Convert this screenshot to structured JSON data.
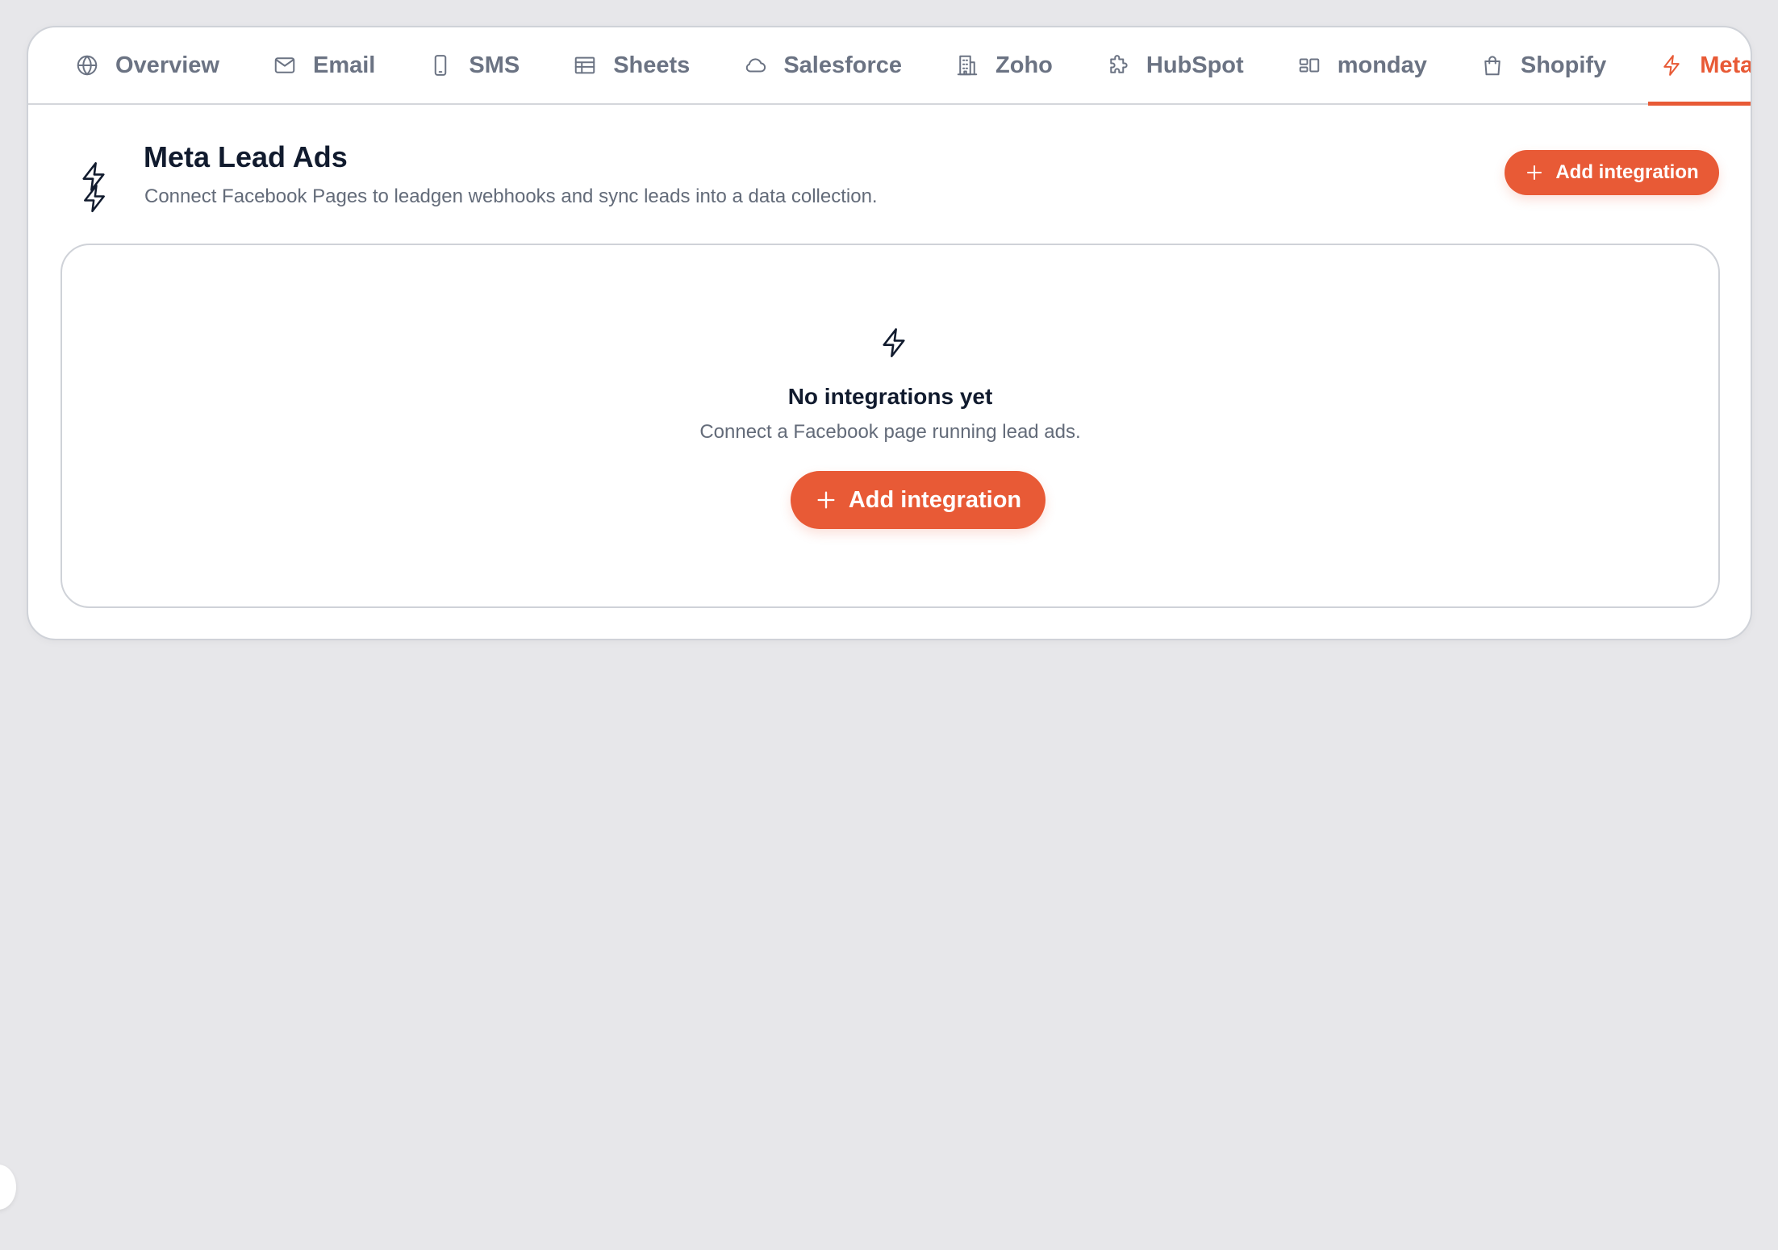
{
  "tabs": [
    {
      "label": "Overview",
      "icon": "globe-icon"
    },
    {
      "label": "Email",
      "icon": "mail-icon"
    },
    {
      "label": "SMS",
      "icon": "phone-icon"
    },
    {
      "label": "Sheets",
      "icon": "table-icon"
    },
    {
      "label": "Salesforce",
      "icon": "cloud-icon"
    },
    {
      "label": "Zoho",
      "icon": "building-icon"
    },
    {
      "label": "HubSpot",
      "icon": "puzzle-icon"
    },
    {
      "label": "monday",
      "icon": "board-icon"
    },
    {
      "label": "Shopify",
      "icon": "shopping-bag-icon"
    },
    {
      "label": "Meta Lea",
      "icon": "lightning-icon",
      "active": true
    }
  ],
  "header": {
    "title": "Meta Lead Ads",
    "subtitle": "Connect Facebook Pages to leadgen webhooks and sync leads into a data collection.",
    "add_button_label": "Add integration",
    "icon": "lightning-icon"
  },
  "empty_state": {
    "icon": "lightning-icon",
    "title": "No integrations yet",
    "subtitle": "Connect a Facebook page running lead ads.",
    "button_label": "Add integration"
  },
  "colors": {
    "accent": "#e85a36",
    "text_primary": "#111b2e",
    "text_muted": "#6b7383",
    "background": "#e7e7ea"
  }
}
